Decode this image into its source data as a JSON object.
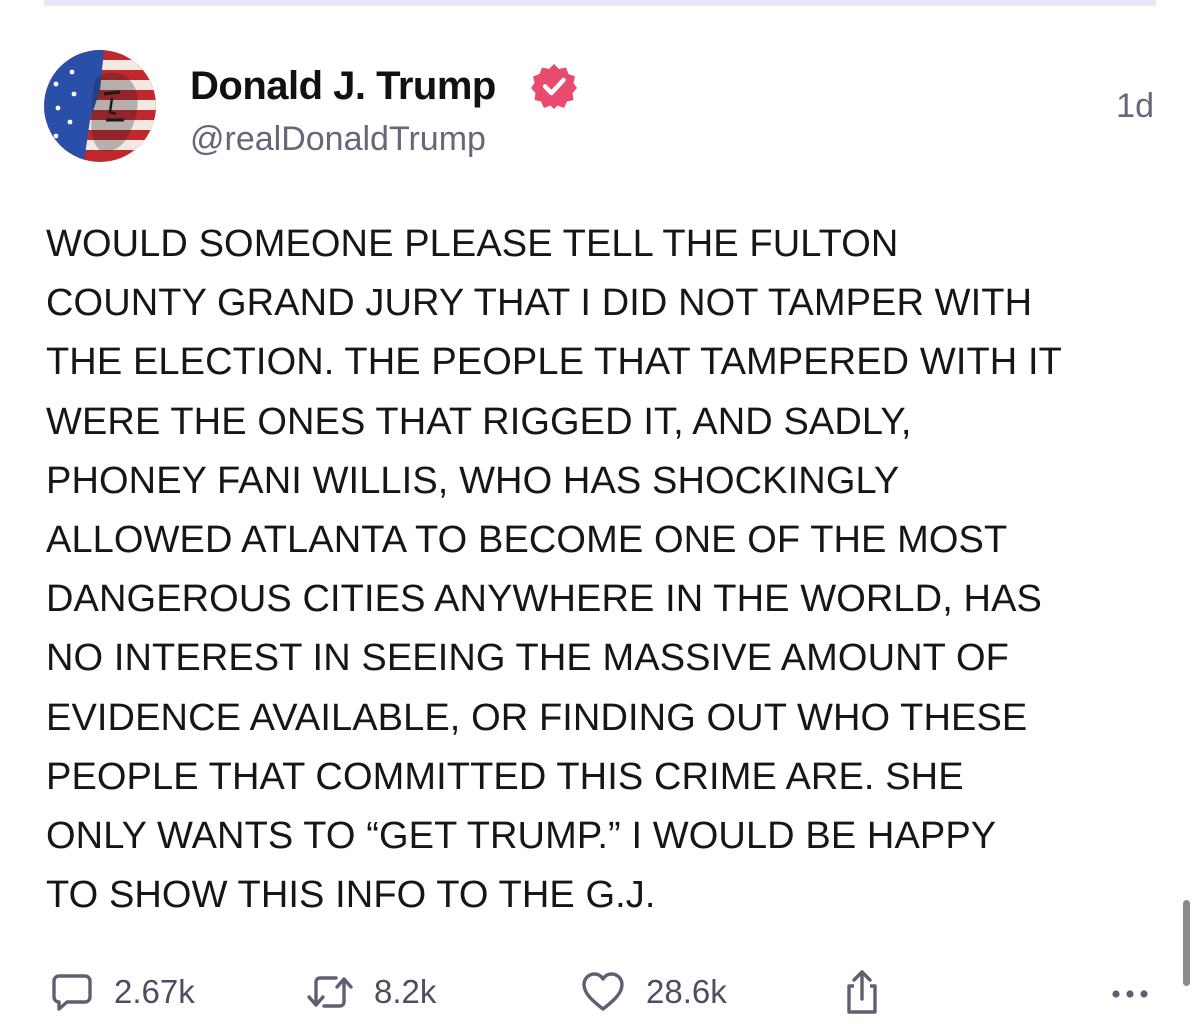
{
  "post": {
    "author": {
      "display_name": "Donald J. Trump",
      "handle": "@realDonaldTrump",
      "verified": true
    },
    "timestamp": "1d",
    "text": "WOULD SOMEONE PLEASE TELL THE FULTON\nCOUNTY GRAND JURY THAT I DID NOT TAMPER WITH\nTHE ELECTION. THE PEOPLE THAT TAMPERED WITH IT\nWERE THE ONES THAT RIGGED IT, AND SADLY,\nPHONEY FANI WILLIS, WHO HAS SHOCKINGLY\nALLOWED ATLANTA TO BECOME ONE OF THE MOST\nDANGEROUS CITIES ANYWHERE IN THE WORLD, HAS\nNO INTEREST IN SEEING THE MASSIVE AMOUNT OF\nEVIDENCE AVAILABLE, OR FINDING OUT WHO THESE\nPEOPLE THAT COMMITTED THIS CRIME ARE. SHE\nONLY WANTS TO “GET TRUMP.” I WOULD BE HAPPY\nTO SHOW THIS INFO TO THE G.J.",
    "actions": {
      "replies": {
        "icon": "reply-icon",
        "count": "2.67k"
      },
      "reposts": {
        "icon": "repost-icon",
        "count": "8.2k"
      },
      "likes": {
        "icon": "heart-icon",
        "count": "28.6k"
      },
      "share": {
        "icon": "share-icon"
      },
      "more": {
        "icon": "more-icon"
      }
    }
  },
  "colors": {
    "verified_badge": "#e94b6f",
    "text_primary": "#161616",
    "text_secondary": "#65677a",
    "divider": "#e8e6f4"
  }
}
